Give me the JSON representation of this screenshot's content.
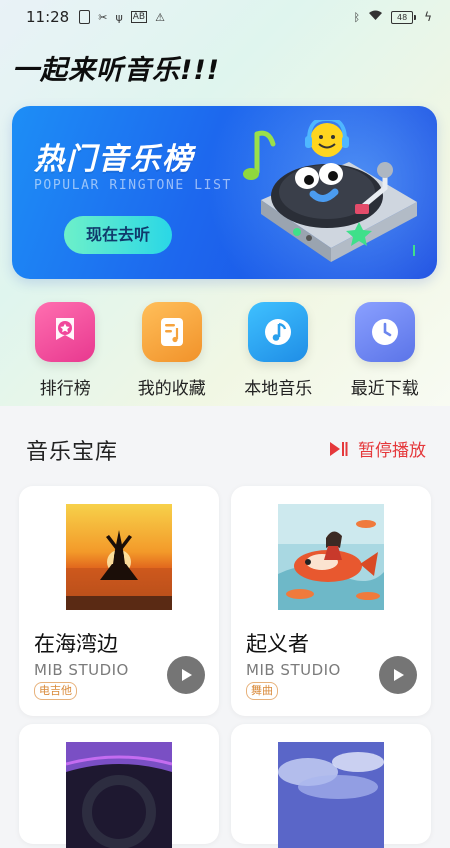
{
  "status_bar": {
    "time": "11:28",
    "left_icons": [
      "sim-card-icon",
      "tools-icon",
      "usb-icon",
      "ab-icon",
      "warning-icon"
    ],
    "right_icons": [
      "bluetooth-icon",
      "wifi-icon",
      "battery-icon",
      "charging-icon"
    ],
    "ab_text": "AB",
    "battery_level": "48"
  },
  "headline": "一起来听音乐!!!",
  "banner": {
    "title": "热门音乐榜",
    "subtitle": "POPULAR RINGTONE LIST",
    "button": "现在去听"
  },
  "quick_links": [
    {
      "label": "排行榜",
      "icon": "award-icon",
      "color": "#f0479b"
    },
    {
      "label": "我的收藏",
      "icon": "favorites-list-icon",
      "color": "#f6a33d"
    },
    {
      "label": "本地音乐",
      "icon": "music-note-icon",
      "color": "#2aa0ec"
    },
    {
      "label": "最近下载",
      "icon": "clock-icon",
      "color": "#6c86ee"
    }
  ],
  "library": {
    "title": "音乐宝库",
    "pause_label": "暂停播放",
    "accent": "#e5383b"
  },
  "songs": [
    {
      "title": "在海湾边",
      "artist": "MIB STUDIO",
      "tag": "电吉他"
    },
    {
      "title": "起义者",
      "artist": "MIB STUDIO",
      "tag": "舞曲"
    },
    {
      "title": "",
      "artist": "",
      "tag": ""
    },
    {
      "title": "",
      "artist": "",
      "tag": ""
    }
  ]
}
